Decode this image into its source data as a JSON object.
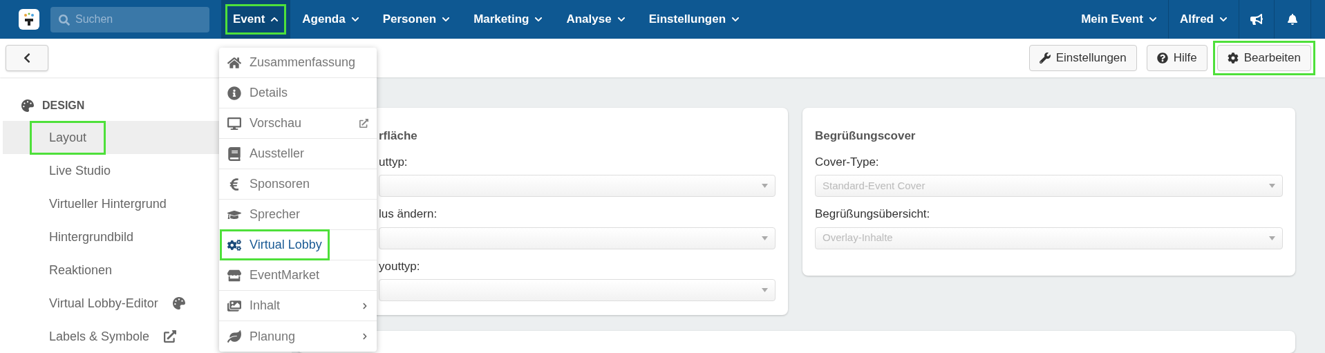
{
  "topbar": {
    "search": {
      "placeholder": "Suchen"
    },
    "nav": [
      {
        "label": "Event",
        "selected": true,
        "highlighted": true
      },
      {
        "label": "Agenda",
        "selected": false,
        "highlighted": false
      },
      {
        "label": "Personen",
        "selected": false,
        "highlighted": false
      },
      {
        "label": "Marketing",
        "selected": false,
        "highlighted": false
      },
      {
        "label": "Analyse",
        "selected": false,
        "highlighted": false
      },
      {
        "label": "Einstellungen",
        "selected": false,
        "highlighted": false
      }
    ],
    "right": [
      {
        "label": "Mein Event"
      },
      {
        "label": "Alfred"
      }
    ]
  },
  "toolbar": {
    "buttons": [
      {
        "label": "Einstellungen",
        "highlighted": false
      },
      {
        "label": "Hilfe",
        "highlighted": false
      },
      {
        "label": "Bearbeiten",
        "highlighted": true
      }
    ]
  },
  "sidebar": {
    "section": "DESIGN",
    "items": [
      {
        "label": "Layout",
        "selected": true,
        "highlighted": true,
        "kind": "plain"
      },
      {
        "label": "Live Studio",
        "selected": false,
        "highlighted": false,
        "kind": "plain"
      },
      {
        "label": "Virtueller Hintergrund",
        "selected": false,
        "highlighted": false,
        "kind": "plain"
      },
      {
        "label": "Hintergrundbild",
        "selected": false,
        "highlighted": false,
        "kind": "plain"
      },
      {
        "label": "Reaktionen",
        "selected": false,
        "highlighted": false,
        "kind": "plain"
      },
      {
        "label": "Virtual Lobby-Editor",
        "selected": false,
        "highlighted": false,
        "kind": "palette"
      },
      {
        "label": "Labels & Symbole",
        "selected": false,
        "highlighted": false,
        "kind": "external"
      }
    ]
  },
  "event_menu": {
    "items": [
      {
        "label": "Zusammenfassung",
        "selected": false,
        "highlighted": false,
        "kind": "plain"
      },
      {
        "label": "Details",
        "selected": false,
        "highlighted": false,
        "kind": "plain"
      },
      {
        "label": "Vorschau",
        "selected": false,
        "highlighted": false,
        "kind": "external"
      },
      {
        "label": "Aussteller",
        "selected": false,
        "highlighted": false,
        "kind": "plain"
      },
      {
        "label": "Sponsoren",
        "selected": false,
        "highlighted": false,
        "kind": "plain"
      },
      {
        "label": "Sprecher",
        "selected": false,
        "highlighted": false,
        "kind": "plain"
      },
      {
        "label": "Virtual Lobby",
        "selected": true,
        "highlighted": true,
        "kind": "plain"
      },
      {
        "label": "EventMarket",
        "selected": false,
        "highlighted": false,
        "kind": "plain"
      },
      {
        "label": "Inhalt",
        "selected": false,
        "highlighted": false,
        "kind": "submenu"
      },
      {
        "label": "Planung",
        "selected": false,
        "highlighted": false,
        "kind": "submenu"
      }
    ]
  },
  "cards": [
    {
      "title": "rfläche",
      "fields": [
        {
          "label": "uttyp:"
        },
        {
          "label": "lus ändern:"
        },
        {
          "label": "youttyp:"
        }
      ]
    },
    {
      "title": "Begrüßungscover",
      "fields": [
        {
          "label": "Cover-Type:",
          "value": "Standard-Event Cover"
        },
        {
          "label": "Begrüßungsübersicht:",
          "value": "Overlay-Inhalte"
        }
      ]
    }
  ]
}
